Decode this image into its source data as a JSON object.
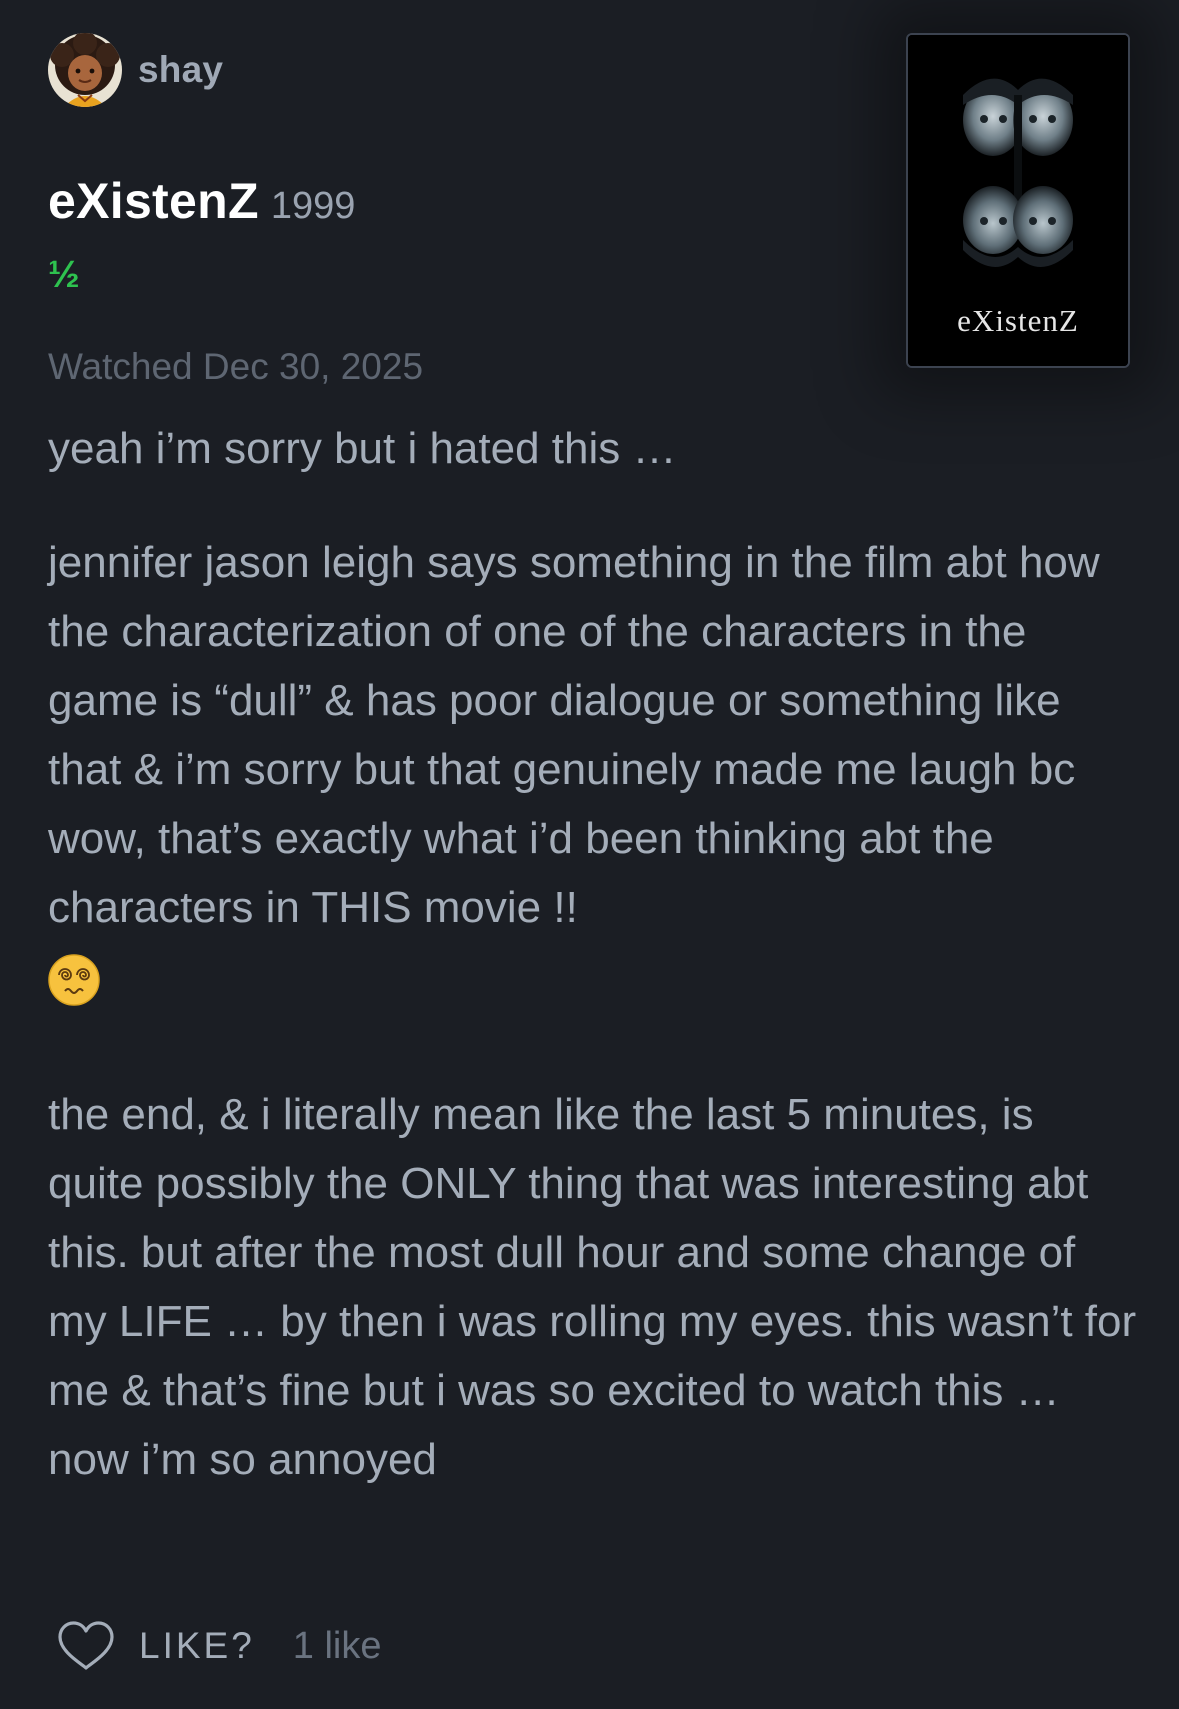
{
  "user": {
    "name": "shay",
    "avatar_icon": "cartoon-avatar-icon"
  },
  "film": {
    "title": "eXistenZ",
    "year": "1999",
    "poster_title": "eXistenZ"
  },
  "rating": {
    "text": "½",
    "stars": 0.5,
    "color": "#2ec24f"
  },
  "watched": "Watched Dec 30, 2025",
  "review": {
    "p1": "yeah i’m sorry but i hated this …",
    "p2": "jennifer jason leigh says something in the film abt how the characterization of one of the characters in the game is “dull” & has poor dialogue or something like that & i’m sorry but that genuinely made me laugh bc wow, that’s exactly what i’d been thinking abt the characters in THIS movie !!",
    "p2_emoji": "face-with-spiral-eyes-icon",
    "p3": "the end, & i literally mean like the last 5 minutes, is quite possibly the ONLY thing that was interesting abt this. but after the most dull hour and some change of my LIFE … by then i was rolling my eyes. this wasn’t for me & that’s fine but i was so excited to watch this … now i’m so annoyed"
  },
  "footer": {
    "like_label": "LIKE?",
    "like_count": "1 like",
    "heart_icon": "heart-outline-icon"
  }
}
